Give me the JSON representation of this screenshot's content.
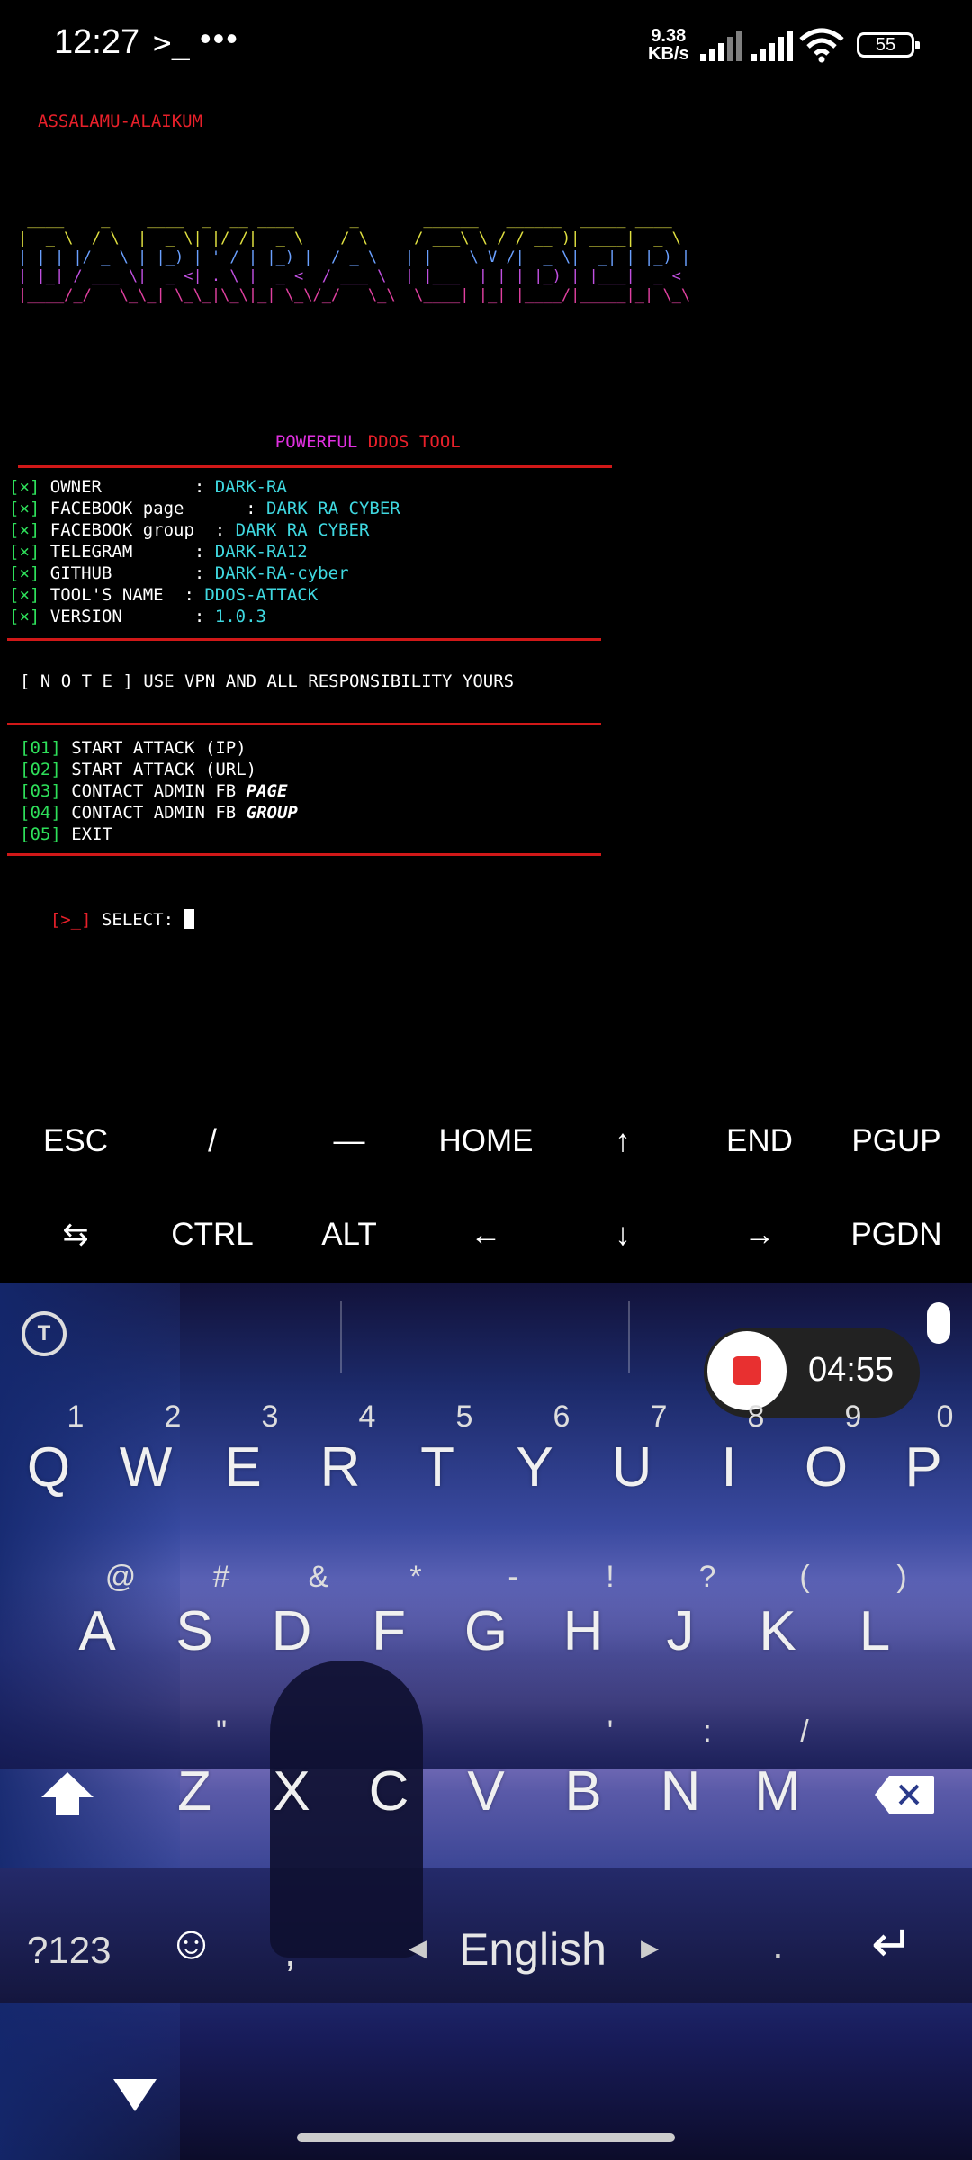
{
  "status_bar": {
    "time": "12:27",
    "prompt_icon": ">_",
    "overflow": "•••",
    "net_speed_value": "9.38",
    "net_speed_unit": "KB/s",
    "battery": "55"
  },
  "terminal": {
    "greeting": "ASSALAMU-ALAIKUM",
    "banner": [
      " ____    _    ____  _  __ ____      _       ______   ______  _____ ____  ",
      "|  _ \\  / \\  |  _ \\| |/ /|  _ \\    / \\     / ___\\ \\ / / __ )| ____|  _ \\ ",
      "| | | |/ _ \\ | |_) | ' / | |_) |  / _ \\   | |    \\ V /|  _ \\|  _| | |_) |",
      "| |_| / ___ \\|  _ <| . \\ |  _ <  / ___ \\  | |___  | | | |_) | |___|  _ < ",
      "|____/_/   \\_\\_| \\_\\_|\\_\\|_| \\_\\/_/   \\_\\  \\____| |_| |____/|_____|_| \\_\\"
    ],
    "tagline_1": "POWERFUL",
    "tagline_2": "DDOS",
    "tagline_3": "TOOL",
    "info": [
      {
        "mark": "[×]",
        "label": " OWNER         : ",
        "value": "DARK-RA"
      },
      {
        "mark": "[×]",
        "label": " FACEBOOK page      : ",
        "value": "DARK RA CYBER"
      },
      {
        "mark": "[×]",
        "label": " FACEBOOK group  : ",
        "value": "DARK RA CYBER"
      },
      {
        "mark": "[×]",
        "label": " TELEGRAM      : ",
        "value": "DARK-RA12"
      },
      {
        "mark": "[×]",
        "label": " GITHUB        : ",
        "value": "DARK-RA-cyber"
      },
      {
        "mark": "[×]",
        "label": " TOOL'S NAME  : ",
        "value": "DDOS-ATTACK"
      },
      {
        "mark": "[×]",
        "label": " VERSION       : ",
        "value": "1.0.3"
      }
    ],
    "note": "[ N O T E ] USE VPN AND ALL RESPONSIBILITY YOURS",
    "menu": [
      {
        "num": "[01]",
        "text": " START ATTACK (IP)",
        "em": ""
      },
      {
        "num": "[02]",
        "text": " START ATTACK (URL)",
        "em": ""
      },
      {
        "num": "[03]",
        "text": " CONTACT ADMIN FB ",
        "em": "PAGE"
      },
      {
        "num": "[04]",
        "text": " CONTACT ADMIN FB ",
        "em": "GROUP"
      },
      {
        "num": "[05]",
        "text": " EXIT",
        "em": ""
      }
    ],
    "prompt_symbol": "[>_]",
    "prompt_text": " SELECT: "
  },
  "extra_keys": {
    "row1": [
      "ESC",
      "/",
      "—",
      "HOME",
      "↑",
      "END",
      "PGUP"
    ],
    "row2": [
      "⇆",
      "CTRL",
      "ALT",
      "←",
      "↓",
      "→",
      "PGDN"
    ]
  },
  "keyboard": {
    "toolbar_icon": "T",
    "recording_timer": "04:55",
    "row1": [
      "Q",
      "W",
      "E",
      "R",
      "T",
      "Y",
      "U",
      "I",
      "O",
      "P"
    ],
    "row1_hints": [
      "1",
      "2",
      "3",
      "4",
      "5",
      "6",
      "7",
      "8",
      "9",
      "0"
    ],
    "row2": [
      "A",
      "S",
      "D",
      "F",
      "G",
      "H",
      "J",
      "K",
      "L"
    ],
    "row2_hints": [
      "@",
      "#",
      "&",
      "*",
      "-",
      "!",
      "?",
      "(",
      ")"
    ],
    "row3": [
      "Z",
      "X",
      "C",
      "V",
      "B",
      "N",
      "M"
    ],
    "row3_hints": [
      "\"",
      "'",
      ":",
      "/"
    ],
    "symbols_key": "?123",
    "comma_key": ",",
    "space_label": "English",
    "period_key": ".",
    "emoji_icon": "☺",
    "enter_icon": "↵"
  }
}
